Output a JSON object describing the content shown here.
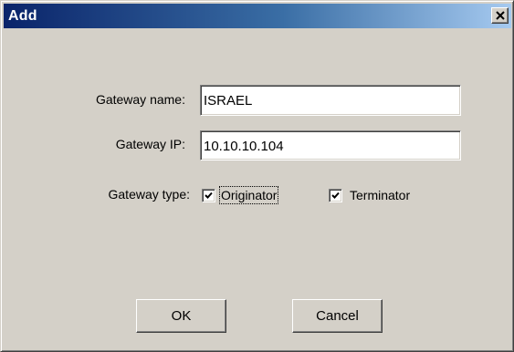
{
  "window": {
    "title": "Add"
  },
  "form": {
    "name_label": "Gateway name:",
    "name_value": "ISRAEL",
    "ip_label": "Gateway IP:",
    "ip_value": "10.10.10.104",
    "type_label": "Gateway type:",
    "originator_label": "Originator",
    "originator_checked": true,
    "terminator_label": "Terminator",
    "terminator_checked": true
  },
  "buttons": {
    "ok_label": "OK",
    "cancel_label": "Cancel"
  },
  "icons": {
    "close": "close-icon",
    "check": "checkmark-icon"
  }
}
